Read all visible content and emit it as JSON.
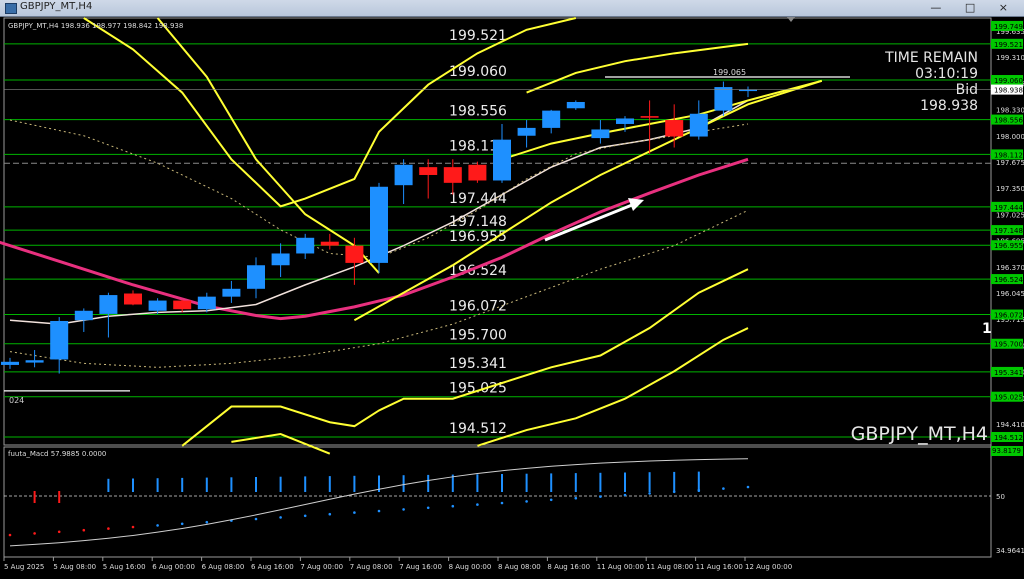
{
  "window": {
    "title": "GBPJPY_MT,H4",
    "min_label": "—",
    "max_label": "□",
    "close_label": "×"
  },
  "header": {
    "symbol_line": "GBPJPY_MT,H4  198.936 198.977 198.842 198.938"
  },
  "info": {
    "time_remain_label": "TIME REMAIN",
    "time_remain_value": "03:10:19",
    "bid_label": "Bid",
    "bid_value": "198.938",
    "watermark": "GBPJPY_MT,H4",
    "left_label": "024",
    "top_line_label": "199.065",
    "partial_level": "1"
  },
  "levels": [
    199.521,
    199.06,
    198.556,
    198.112,
    197.444,
    197.148,
    196.955,
    196.524,
    196.072,
    195.7,
    195.341,
    195.025,
    194.512
  ],
  "price_axis": {
    "ticks": [
      "199.635",
      "199.310",
      "198.655",
      "198.330",
      "198.000",
      "197.675",
      "197.350",
      "197.025",
      "196.695",
      "196.370",
      "196.045",
      "195.715",
      "195.390",
      "195.060",
      "194.740",
      "194.410"
    ],
    "green_tags": [
      "199.749",
      "199.521",
      "199.060",
      "198.556",
      "198.112",
      "197.444",
      "197.148",
      "196.955",
      "196.524",
      "196.072",
      "195.700",
      "195.341",
      "195.025",
      "194.512"
    ],
    "current_tag": "198.938"
  },
  "time_axis": [
    "5 Aug 2025",
    "5 Aug 08:00",
    "5 Aug 16:00",
    "6 Aug 00:00",
    "6 Aug 08:00",
    "6 Aug 16:00",
    "7 Aug 00:00",
    "7 Aug 08:00",
    "7 Aug 16:00",
    "8 Aug 00:00",
    "8 Aug 08:00",
    "8 Aug 16:00",
    "11 Aug 00:00",
    "11 Aug 08:00",
    "11 Aug 16:00",
    "12 Aug 00:00"
  ],
  "macd": {
    "label": "fuuta_Macd 57.9885  0.0000",
    "axis_top": "93.8179",
    "axis_mid": "50",
    "axis_bottom": "34.9641"
  },
  "colors": {
    "bull": "#1e90ff",
    "bear": "#ff1a1a",
    "bollinger": "#ffff33",
    "ma_long": "#e8307f",
    "ma_short": "#f2e2dc",
    "level_line": "#00b400",
    "tag_bg": "#00c800"
  },
  "chart_data": {
    "type": "candlestick",
    "symbol": "GBPJPY_MT",
    "timeframe": "H4",
    "ylim": [
      194.41,
      199.85
    ],
    "x": [
      "5 Aug 2025",
      "5 Aug 04:00",
      "5 Aug 08:00",
      "5 Aug 12:00",
      "5 Aug 16:00",
      "5 Aug 20:00",
      "6 Aug 00:00",
      "6 Aug 04:00",
      "6 Aug 08:00",
      "6 Aug 12:00",
      "6 Aug 16:00",
      "6 Aug 20:00",
      "7 Aug 00:00",
      "7 Aug 04:00",
      "7 Aug 08:00",
      "7 Aug 12:00",
      "7 Aug 16:00",
      "7 Aug 20:00",
      "8 Aug 00:00",
      "8 Aug 04:00",
      "8 Aug 08:00",
      "8 Aug 12:00",
      "8 Aug 16:00",
      "8 Aug 20:00",
      "11 Aug 00:00",
      "11 Aug 04:00",
      "11 Aug 08:00",
      "11 Aug 12:00",
      "11 Aug 16:00",
      "11 Aug 20:00",
      "12 Aug 00:00"
    ],
    "candles": [
      {
        "o": 195.43,
        "h": 195.52,
        "l": 195.38,
        "c": 195.47
      },
      {
        "o": 195.46,
        "h": 195.62,
        "l": 195.4,
        "c": 195.49
      },
      {
        "o": 195.5,
        "h": 196.04,
        "l": 195.32,
        "c": 195.99
      },
      {
        "o": 196.0,
        "h": 196.15,
        "l": 195.85,
        "c": 196.12
      },
      {
        "o": 196.08,
        "h": 196.35,
        "l": 195.78,
        "c": 196.32
      },
      {
        "o": 196.34,
        "h": 196.38,
        "l": 196.19,
        "c": 196.2
      },
      {
        "o": 196.12,
        "h": 196.28,
        "l": 196.08,
        "c": 196.25
      },
      {
        "o": 196.25,
        "h": 196.26,
        "l": 196.1,
        "c": 196.14
      },
      {
        "o": 196.14,
        "h": 196.35,
        "l": 196.1,
        "c": 196.3
      },
      {
        "o": 196.3,
        "h": 196.5,
        "l": 196.22,
        "c": 196.4
      },
      {
        "o": 196.4,
        "h": 196.8,
        "l": 196.28,
        "c": 196.7
      },
      {
        "o": 196.7,
        "h": 196.98,
        "l": 196.55,
        "c": 196.85
      },
      {
        "o": 196.85,
        "h": 197.1,
        "l": 196.78,
        "c": 197.05
      },
      {
        "o": 197.0,
        "h": 197.1,
        "l": 196.9,
        "c": 196.95
      },
      {
        "o": 196.95,
        "h": 197.05,
        "l": 196.45,
        "c": 196.73
      },
      {
        "o": 196.73,
        "h": 197.75,
        "l": 196.6,
        "c": 197.7
      },
      {
        "o": 197.72,
        "h": 198.05,
        "l": 197.48,
        "c": 197.98
      },
      {
        "o": 197.95,
        "h": 198.05,
        "l": 197.55,
        "c": 197.85
      },
      {
        "o": 197.95,
        "h": 198.05,
        "l": 197.6,
        "c": 197.75
      },
      {
        "o": 197.98,
        "h": 198.02,
        "l": 197.75,
        "c": 197.78
      },
      {
        "o": 197.78,
        "h": 198.5,
        "l": 197.75,
        "c": 198.3
      },
      {
        "o": 198.35,
        "h": 198.55,
        "l": 198.2,
        "c": 198.45
      },
      {
        "o": 198.45,
        "h": 198.68,
        "l": 198.38,
        "c": 198.67
      },
      {
        "o": 198.7,
        "h": 198.8,
        "l": 198.68,
        "c": 198.78
      },
      {
        "o": 198.32,
        "h": 198.55,
        "l": 198.25,
        "c": 198.43
      },
      {
        "o": 198.5,
        "h": 198.6,
        "l": 198.4,
        "c": 198.57
      },
      {
        "o": 198.6,
        "h": 198.8,
        "l": 198.12,
        "c": 198.58
      },
      {
        "o": 198.55,
        "h": 198.75,
        "l": 198.2,
        "c": 198.34
      },
      {
        "o": 198.34,
        "h": 198.8,
        "l": 198.3,
        "c": 198.63
      },
      {
        "o": 198.67,
        "h": 199.04,
        "l": 198.6,
        "c": 198.97
      },
      {
        "o": 198.936,
        "h": 198.977,
        "l": 198.842,
        "c": 198.938
      }
    ]
  }
}
